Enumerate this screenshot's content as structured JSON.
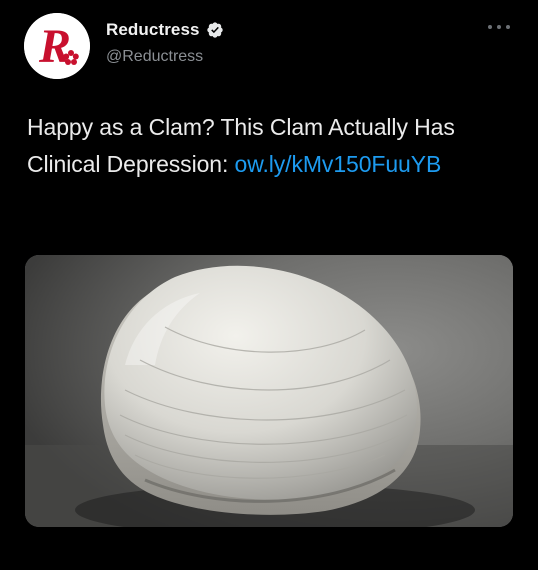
{
  "account": {
    "display_name": "Reductress",
    "handle": "@Reductress",
    "verified": true,
    "avatar_letter": "R",
    "avatar_color": "#c8102e"
  },
  "tweet": {
    "text": "Happy as a Clam? This Clam Actually Has Clinical Depression: ",
    "link_text": "ow.ly/kMv150FuuYB"
  },
  "colors": {
    "background": "#000000",
    "link": "#1d9bf0",
    "verified_badge": "#1d9bf0",
    "muted": "#8b8f94"
  },
  "icons": {
    "more": "more-options-icon",
    "verified": "verified-badge-icon"
  }
}
